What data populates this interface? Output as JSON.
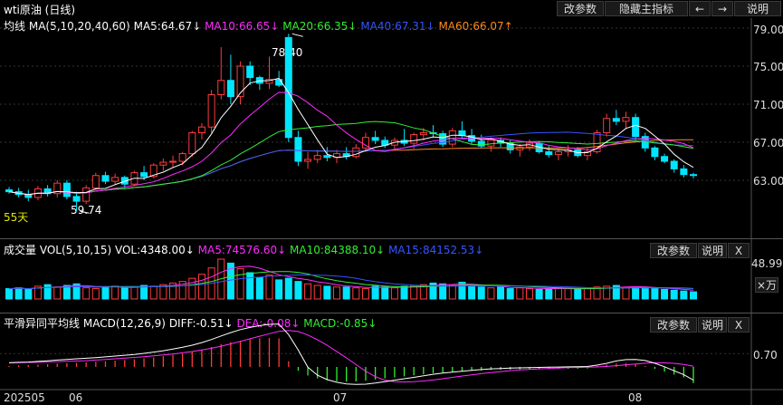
{
  "window": {
    "title": "wti原油 (日线)"
  },
  "toolbar": {
    "params": "改参数",
    "hide_main": "隐藏主指标",
    "prev": "←",
    "next": "→",
    "help": "说明"
  },
  "ma_header": {
    "label": "均线",
    "spec": "MA(5,10,20,40,60)",
    "ma5": "MA5:64.67↓",
    "ma10": "MA10:66.65↓",
    "ma20": "MA20:66.35↓",
    "ma40": "MA40:67.31↓",
    "ma60": "MA60:66.07↑"
  },
  "price_axis": [
    "79.00",
    "75.00",
    "71.00",
    "67.00",
    "63.00"
  ],
  "annotations": {
    "high": "78.40",
    "low": "59.74",
    "days": "55天"
  },
  "vol_header": {
    "label": "成交量",
    "spec": "VOL(5,10,15)",
    "vol": "VOL:4348.00↓",
    "ma5": "MA5:74576.60↓",
    "ma10": "MA10:84388.10↓",
    "ma15": "MA15:84152.53↓"
  },
  "vol_axis": {
    "value": "48.99",
    "unit": "×万"
  },
  "vol_buttons": {
    "params": "改参数",
    "help": "说明",
    "close": "X"
  },
  "macd_header": {
    "label": "平滑异同平均线",
    "spec": "MACD(12,26,9)",
    "diff": "DIFF:-0.51↓",
    "dea": "DEA:-0.08↓",
    "macd": "MACD:-0.85↓"
  },
  "macd_axis": [
    "0.70"
  ],
  "macd_buttons": {
    "params": "改参数",
    "help": "说明",
    "close": "X"
  },
  "date_axis": [
    "202505",
    "06",
    "07",
    "08"
  ],
  "colors": {
    "up": "#ff3b3b",
    "down": "#00e5ff",
    "ma5": "#ffffff",
    "ma10": "#ff2bff",
    "ma20": "#33ee33",
    "ma40": "#3355ff",
    "ma60": "#ff8c1a"
  },
  "chart_data": {
    "type": "candlestick",
    "ohlc": [
      [
        62.0,
        62.3,
        61.6,
        61.8
      ],
      [
        61.8,
        62.2,
        61.2,
        61.5
      ],
      [
        61.5,
        62.0,
        60.8,
        61.2
      ],
      [
        61.2,
        62.4,
        60.9,
        62.1
      ],
      [
        62.1,
        62.5,
        61.3,
        61.6
      ],
      [
        61.6,
        63.0,
        61.2,
        62.7
      ],
      [
        62.7,
        63.0,
        61.0,
        61.3
      ],
      [
        61.3,
        61.8,
        59.74,
        60.8
      ],
      [
        60.8,
        62.5,
        60.5,
        62.2
      ],
      [
        62.2,
        63.8,
        62.0,
        63.5
      ],
      [
        63.5,
        63.9,
        62.6,
        62.9
      ],
      [
        62.9,
        63.7,
        62.5,
        63.3
      ],
      [
        63.3,
        63.5,
        62.2,
        62.6
      ],
      [
        62.6,
        64.0,
        62.4,
        63.8
      ],
      [
        63.8,
        64.5,
        63.0,
        63.4
      ],
      [
        63.4,
        64.8,
        63.2,
        64.6
      ],
      [
        64.6,
        65.3,
        64.0,
        64.9
      ],
      [
        64.9,
        65.6,
        64.3,
        65.0
      ],
      [
        65.0,
        66.0,
        64.6,
        65.8
      ],
      [
        65.8,
        68.2,
        65.5,
        68.0
      ],
      [
        68.0,
        69.0,
        67.3,
        68.6
      ],
      [
        68.6,
        72.5,
        68.0,
        72.0
      ],
      [
        72.0,
        77.0,
        71.5,
        73.5
      ],
      [
        73.5,
        76.2,
        71.0,
        71.8
      ],
      [
        71.8,
        75.5,
        71.0,
        75.0
      ],
      [
        75.0,
        75.5,
        73.0,
        73.8
      ],
      [
        73.8,
        74.0,
        72.5,
        73.2
      ],
      [
        73.2,
        76.0,
        72.6,
        73.6
      ],
      [
        73.6,
        74.5,
        72.8,
        73.0
      ],
      [
        78.0,
        78.4,
        67.0,
        67.5
      ],
      [
        67.5,
        68.2,
        64.5,
        65.0
      ],
      [
        65.0,
        66.0,
        64.2,
        65.2
      ],
      [
        65.2,
        66.2,
        64.8,
        65.6
      ],
      [
        65.6,
        66.5,
        65.0,
        65.4
      ],
      [
        65.4,
        66.2,
        64.8,
        65.8
      ],
      [
        65.8,
        66.5,
        65.2,
        65.5
      ],
      [
        65.5,
        66.8,
        65.3,
        66.4
      ],
      [
        66.4,
        68.0,
        66.0,
        67.5
      ],
      [
        67.5,
        68.2,
        66.8,
        67.2
      ],
      [
        67.2,
        67.6,
        66.4,
        66.7
      ],
      [
        66.7,
        67.5,
        66.2,
        67.2
      ],
      [
        67.2,
        68.4,
        66.6,
        66.9
      ],
      [
        66.9,
        68.0,
        66.3,
        67.8
      ],
      [
        67.8,
        68.5,
        67.2,
        68.0
      ],
      [
        68.0,
        68.8,
        67.5,
        67.9
      ],
      [
        67.9,
        68.2,
        66.5,
        66.8
      ],
      [
        66.8,
        68.5,
        66.5,
        68.2
      ],
      [
        68.2,
        69.2,
        67.5,
        67.7
      ],
      [
        67.7,
        68.4,
        66.8,
        67.1
      ],
      [
        67.1,
        67.8,
        66.4,
        66.6
      ],
      [
        66.6,
        67.5,
        66.0,
        67.2
      ],
      [
        67.2,
        67.5,
        66.5,
        66.9
      ],
      [
        66.9,
        67.2,
        65.8,
        66.2
      ],
      [
        66.2,
        66.8,
        65.5,
        66.5
      ],
      [
        66.5,
        67.3,
        66.1,
        66.9
      ],
      [
        66.9,
        67.1,
        65.8,
        66.0
      ],
      [
        66.0,
        66.6,
        65.4,
        65.7
      ],
      [
        65.7,
        66.3,
        65.1,
        66.0
      ],
      [
        66.0,
        66.7,
        65.5,
        66.2
      ],
      [
        66.2,
        66.5,
        65.4,
        65.6
      ],
      [
        65.6,
        66.4,
        65.1,
        66.0
      ],
      [
        66.0,
        68.3,
        65.8,
        68.0
      ],
      [
        68.0,
        70.0,
        67.6,
        69.5
      ],
      [
        69.5,
        70.4,
        68.8,
        69.2
      ],
      [
        69.2,
        70.2,
        68.4,
        69.6
      ],
      [
        69.6,
        70.0,
        67.2,
        67.6
      ],
      [
        67.6,
        68.0,
        66.0,
        66.4
      ],
      [
        66.4,
        66.6,
        65.1,
        65.5
      ],
      [
        65.5,
        65.8,
        64.8,
        65.0
      ],
      [
        65.0,
        65.2,
        63.8,
        64.2
      ],
      [
        64.2,
        64.6,
        63.3,
        63.6
      ],
      [
        63.6,
        63.8,
        63.2,
        63.5
      ]
    ],
    "volume": [
      13,
      14,
      12,
      16,
      18,
      15,
      17,
      19,
      14,
      13,
      15,
      16,
      14,
      15,
      17,
      16,
      18,
      20,
      22,
      26,
      31,
      39,
      50,
      45,
      38,
      33,
      27,
      30,
      24,
      26,
      22,
      19,
      17,
      16,
      15,
      15,
      14,
      13,
      16,
      15,
      14,
      16,
      17,
      18,
      20,
      19,
      17,
      21,
      16,
      15,
      14,
      15,
      13,
      14,
      13,
      12,
      13,
      14,
      13,
      12,
      13,
      15,
      16,
      17,
      14,
      15,
      14,
      13,
      12,
      11,
      10,
      9
    ],
    "macd": [
      0.05,
      0.08,
      0.1,
      0.12,
      0.15,
      0.18,
      0.2,
      0.22,
      0.24,
      0.27,
      0.3,
      0.33,
      0.36,
      0.4,
      0.45,
      0.5,
      0.56,
      0.63,
      0.7,
      0.8,
      0.92,
      1.05,
      1.2,
      1.3,
      1.38,
      1.45,
      1.5,
      1.52,
      1.5,
      0.3,
      -0.2,
      -0.45,
      -0.6,
      -0.7,
      -0.75,
      -0.78,
      -0.76,
      -0.72,
      -0.66,
      -0.6,
      -0.55,
      -0.5,
      -0.44,
      -0.38,
      -0.33,
      -0.3,
      -0.27,
      -0.24,
      -0.2,
      -0.18,
      -0.16,
      -0.15,
      -0.14,
      -0.13,
      -0.12,
      -0.12,
      -0.11,
      -0.1,
      -0.1,
      -0.09,
      -0.08,
      0.05,
      0.12,
      0.18,
      0.2,
      0.15,
      0.05,
      -0.1,
      -0.25,
      -0.4,
      -0.55,
      -0.85
    ]
  }
}
